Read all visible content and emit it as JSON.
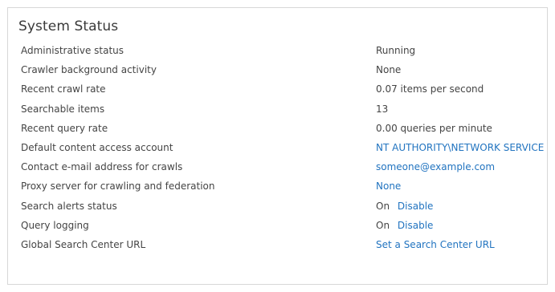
{
  "title": "System Status",
  "rows": [
    {
      "label": "Administrative status",
      "value": "Running"
    },
    {
      "label": "Crawler background activity",
      "value": "None"
    },
    {
      "label": "Recent crawl rate",
      "value": "0.07 items per second"
    },
    {
      "label": "Searchable items",
      "value": "13"
    },
    {
      "label": "Recent query rate",
      "value": "0.00 queries per minute"
    },
    {
      "label": "Default content access account",
      "link": "NT AUTHORITY\\NETWORK SERVICE"
    },
    {
      "label": "Contact e-mail address for crawls",
      "link": "someone@example.com"
    },
    {
      "label": "Proxy server for crawling and federation",
      "link": "None"
    },
    {
      "label": "Search alerts status",
      "value": "On",
      "link": "Disable"
    },
    {
      "label": "Query logging",
      "value": "On",
      "link": "Disable"
    },
    {
      "label": "Global Search Center URL",
      "link": "Set a Search Center URL"
    }
  ],
  "colors": {
    "link": "#2274c0",
    "text": "#444444",
    "title": "#3a3a3a",
    "border": "#d7d7d7"
  }
}
